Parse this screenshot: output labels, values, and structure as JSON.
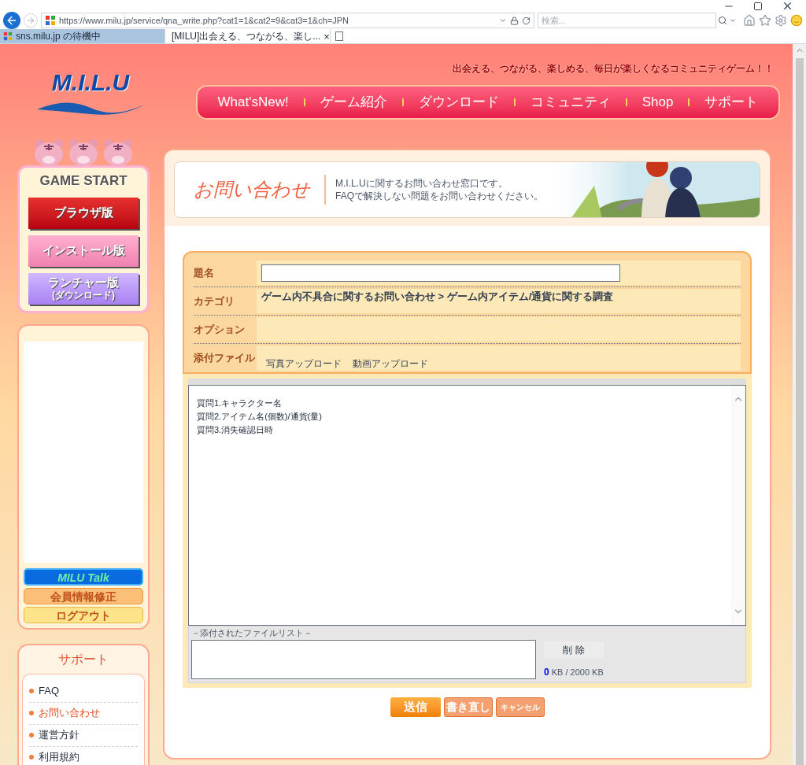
{
  "browser": {
    "url": "https://www.milu.jp/service/qna_write.php?cat1=1&cat2=9&cat3=1&ch=JPN",
    "search": {
      "placeholder": "検索..."
    },
    "tabs": [
      {
        "label": "sns.milu.jp の待機中",
        "selected": false
      },
      {
        "label": "[MILU]出会える、つながる、楽し...",
        "selected": true
      }
    ],
    "close_tab": "×"
  },
  "site": {
    "logo": "M.I.L.U",
    "tagline": "出会える、つながる、楽しめる、毎日が楽しくなるコミュニティゲーム！！",
    "nav": [
      "What'sNew!",
      "ゲーム紹介",
      "ダウンロード",
      "コミュニティ",
      "Shop",
      "サポート"
    ]
  },
  "sidebar": {
    "game_start": "GAME START",
    "start_buttons": [
      {
        "label": "ブラウザ版",
        "kind": "red"
      },
      {
        "label": "インストール版",
        "kind": "pink"
      },
      {
        "label": "ランチャー版",
        "sub": "(ダウンロード)",
        "kind": "purple"
      }
    ],
    "talk": "MILU Talk",
    "member_buttons": [
      {
        "label": "会員情報修正",
        "kind": "orange"
      },
      {
        "label": "ログアウト",
        "kind": "yellow"
      }
    ],
    "support": {
      "title": "サポート",
      "items": [
        {
          "label": "FAQ",
          "selected": false
        },
        {
          "label": "お問い合わせ",
          "selected": true
        },
        {
          "label": "運営方針",
          "selected": false
        },
        {
          "label": "利用規約",
          "selected": false
        }
      ]
    }
  },
  "page": {
    "title": "お問い合わせ",
    "description": [
      "M.I.L.Uに関するお問い合わせ窓口です。",
      "FAQで解決しない問題をお問い合わせください。"
    ]
  },
  "form": {
    "fields": [
      {
        "label": "題名",
        "kind": "input"
      },
      {
        "label": "カテゴリ",
        "kind": "text",
        "value": "ゲーム内不具合に関するお問い合わせ > ゲーム内アイテム/通貨に関する調査"
      },
      {
        "label": "オプション",
        "kind": "empty"
      },
      {
        "label": "添付ファイル",
        "kind": "links",
        "links": [
          "写真アップロード",
          "動画アップロード"
        ]
      }
    ],
    "body": [
      "質問1.キャラクター名",
      "質問2.アイテム名(個数)/通貨(量)",
      "質問3.消失確認日時"
    ],
    "file_list_label": "－添付されたファイルリスト－",
    "delete": "削 除",
    "size_used": "0",
    "size_total": "KB / 2000 KB",
    "buttons": [
      {
        "label": "送信",
        "kind": "primary"
      },
      {
        "label": "書き直し",
        "kind": "secondary"
      },
      {
        "label": "キャンセル",
        "kind": "small"
      }
    ]
  }
}
